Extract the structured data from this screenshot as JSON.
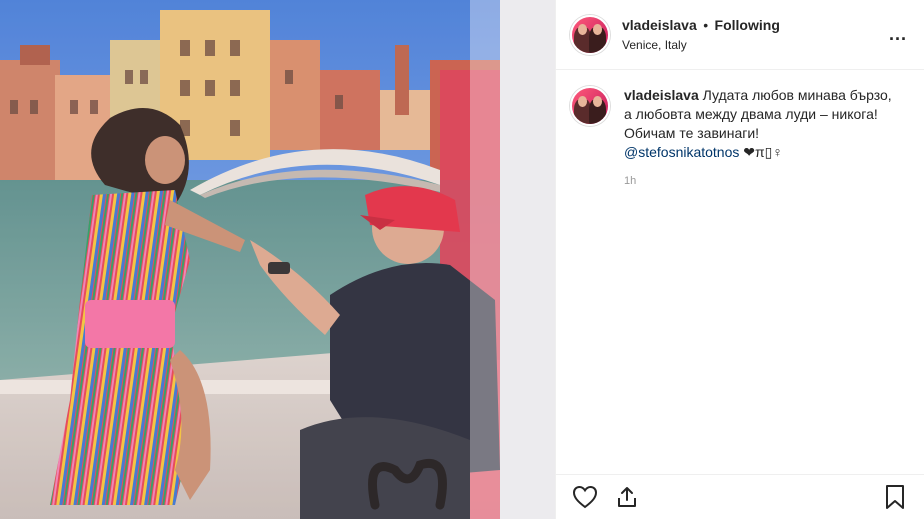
{
  "post": {
    "username": "vladeislava",
    "separator": "•",
    "follow_label": "Following",
    "location": "Venice, Italy",
    "more_label": "..."
  },
  "caption": {
    "username": "vladeislava",
    "text": "Лудата любов минава бързо, а любовта между двама луди – никога! Обичам те завинаги!",
    "mention": "@stefosnikatotnos",
    "emoji": "❤π▯♀",
    "time": "1h"
  },
  "icons": {
    "like": "heart-icon",
    "share": "share-icon",
    "save": "bookmark-icon",
    "more": "more-icon"
  },
  "colors": {
    "sky": "#4a8ae0",
    "water": "#3f7a7e",
    "accent": "#e0233a",
    "mention": "#003569"
  }
}
